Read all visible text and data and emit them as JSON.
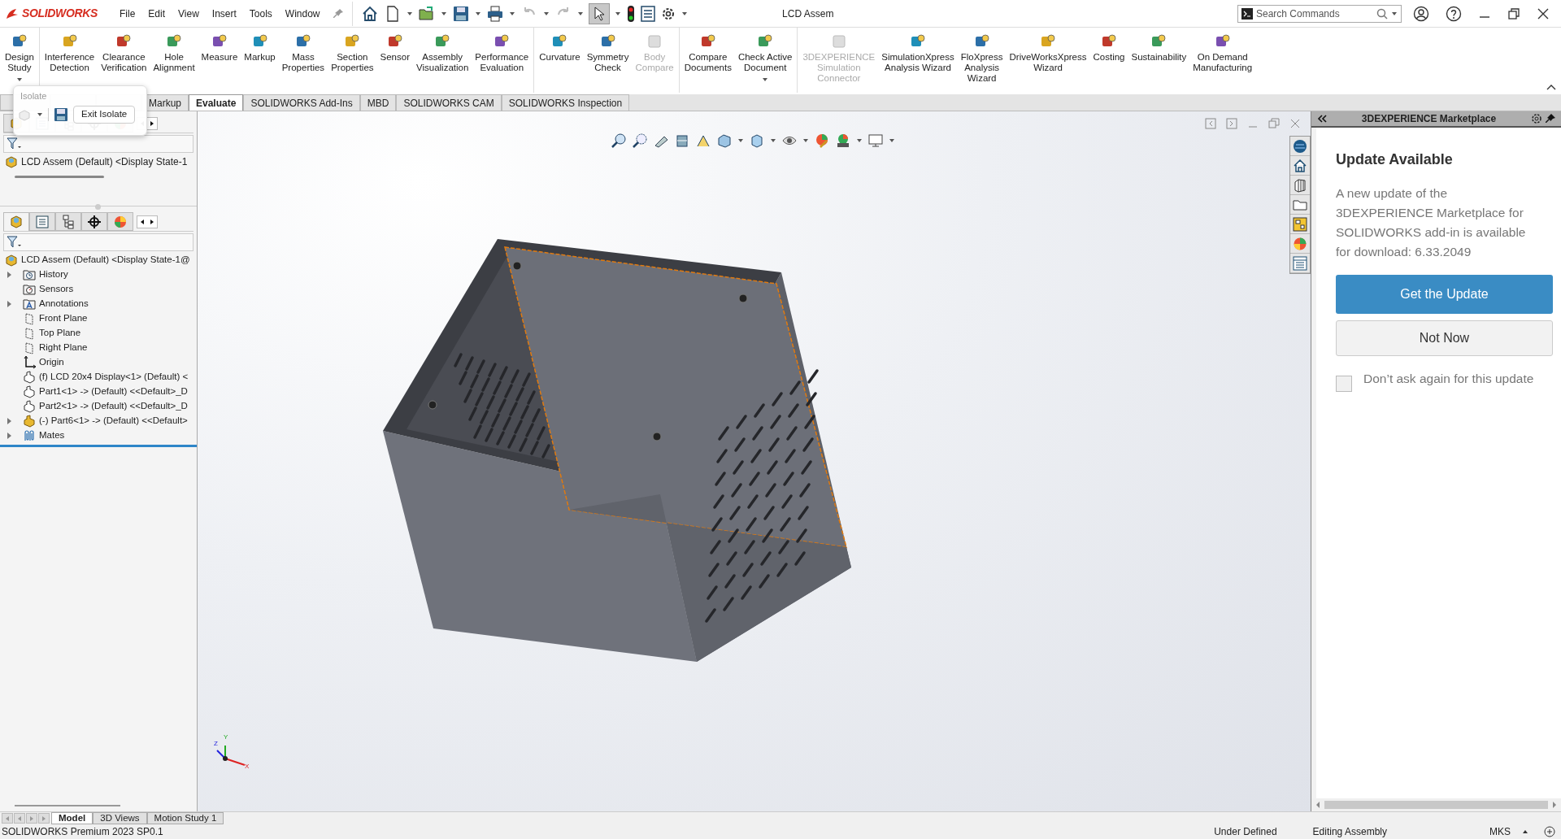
{
  "app": {
    "logo": "SOLIDWORKS",
    "title": "LCD Assem"
  },
  "menu": [
    "File",
    "Edit",
    "View",
    "Insert",
    "Tools",
    "Window"
  ],
  "search": {
    "placeholder": "Search Commands"
  },
  "ribbon": {
    "groups": [
      [
        {
          "lines": [
            "Design",
            "Study"
          ],
          "disabled": false,
          "has_menu": true
        }
      ],
      [
        {
          "lines": [
            "Interference",
            "Detection"
          ],
          "disabled": false
        },
        {
          "lines": [
            "Clearance",
            "Verification"
          ],
          "disabled": false
        },
        {
          "lines": [
            "Hole",
            "Alignment"
          ],
          "disabled": false
        },
        {
          "lines": [
            "Measure"
          ],
          "disabled": false
        },
        {
          "lines": [
            "Markup"
          ],
          "disabled": false
        },
        {
          "lines": [
            "Mass",
            "Properties"
          ],
          "disabled": false
        },
        {
          "lines": [
            "Section",
            "Properties"
          ],
          "disabled": false
        },
        {
          "lines": [
            "Sensor"
          ],
          "disabled": false
        },
        {
          "lines": [
            "Assembly",
            "Visualization"
          ],
          "disabled": false
        },
        {
          "lines": [
            "Performance",
            "Evaluation"
          ],
          "disabled": false
        }
      ],
      [
        {
          "lines": [
            "Curvature"
          ],
          "disabled": false
        },
        {
          "lines": [
            "Symmetry",
            "Check"
          ],
          "disabled": false
        },
        {
          "lines": [
            "Body",
            "Compare"
          ],
          "disabled": true
        }
      ],
      [
        {
          "lines": [
            "Compare",
            "Documents"
          ],
          "disabled": false
        },
        {
          "lines": [
            "Check Active",
            "Document"
          ],
          "disabled": false,
          "has_menu": true
        }
      ],
      [
        {
          "lines": [
            "3DEXPERIENCE",
            "Simulation",
            "Connector"
          ],
          "disabled": true
        },
        {
          "lines": [
            "SimulationXpress",
            "Analysis Wizard"
          ],
          "disabled": false
        },
        {
          "lines": [
            "FloXpress",
            "Analysis",
            "Wizard"
          ],
          "disabled": false
        },
        {
          "lines": [
            "DriveWorksXpress",
            "Wizard"
          ],
          "disabled": false
        },
        {
          "lines": [
            "Costing"
          ],
          "disabled": false
        },
        {
          "lines": [
            "Sustainability"
          ],
          "disabled": false
        },
        {
          "lines": [
            "On Demand",
            "Manufacturing"
          ],
          "disabled": false
        }
      ]
    ]
  },
  "tabs": [
    {
      "label": "Markup",
      "selected": false
    },
    {
      "label": "Evaluate",
      "selected": true
    },
    {
      "label": "SOLIDWORKS Add-Ins",
      "selected": false
    },
    {
      "label": "MBD",
      "selected": false
    },
    {
      "label": "SOLIDWORKS CAM",
      "selected": false
    },
    {
      "label": "SOLIDWORKS Inspection",
      "selected": false
    }
  ],
  "isolate_popup": {
    "title": "Isolate",
    "button": "Exit Isolate"
  },
  "mini_tree": {
    "root": "LCD Assem (Default) <Display State-1"
  },
  "feature_tree": {
    "tabs": [
      {
        "selected": true
      },
      {
        "selected": false
      },
      {
        "selected": false
      },
      {
        "selected": false
      },
      {
        "selected": false
      }
    ],
    "root": {
      "label": "LCD Assem (Default) <Display State-1@",
      "children": [
        {
          "label": "History",
          "kind": "history",
          "expanded": false
        },
        {
          "label": "Sensors",
          "kind": "sensors"
        },
        {
          "label": "Annotations",
          "kind": "annotations",
          "expanded": false
        },
        {
          "label": "Front Plane",
          "kind": "plane"
        },
        {
          "label": "Top Plane",
          "kind": "plane"
        },
        {
          "label": "Right Plane",
          "kind": "plane"
        },
        {
          "label": "Origin",
          "kind": "origin"
        },
        {
          "label": "(f) LCD 20x4 Display<1> (Default) <",
          "kind": "part"
        },
        {
          "label": "Part1<1> -> (Default) <<Default>_D",
          "kind": "part"
        },
        {
          "label": "Part2<1> -> (Default) <<Default>_D",
          "kind": "part"
        },
        {
          "label": "(-) Part6<1> -> (Default) <<Default>",
          "kind": "assembly",
          "expanded": false
        },
        {
          "label": "Mates",
          "kind": "mates",
          "expanded": false
        }
      ]
    }
  },
  "triad": {
    "x": "X",
    "y": "Y",
    "z": "Z"
  },
  "task_pane": {
    "title": "3DEXPERIENCE Marketplace",
    "heading": "Update Available",
    "message": "A new update of the 3DEXPERIENCE Marketplace for SOLIDWORKS add-in is available for download: 6.33.2049",
    "primary": "Get the Update",
    "secondary": "Not Now",
    "checkbox": {
      "label": "Don’t ask again for this update",
      "checked": false
    }
  },
  "bottom_tabs": [
    {
      "label": "Model",
      "selected": true
    },
    {
      "label": "3D Views",
      "selected": false
    },
    {
      "label": "Motion Study 1",
      "selected": false
    }
  ],
  "status_bar": {
    "product": "SOLIDWORKS Premium 2023 SP0.1",
    "state": "Under Defined",
    "mode": "Editing Assembly",
    "units": "MKS"
  }
}
